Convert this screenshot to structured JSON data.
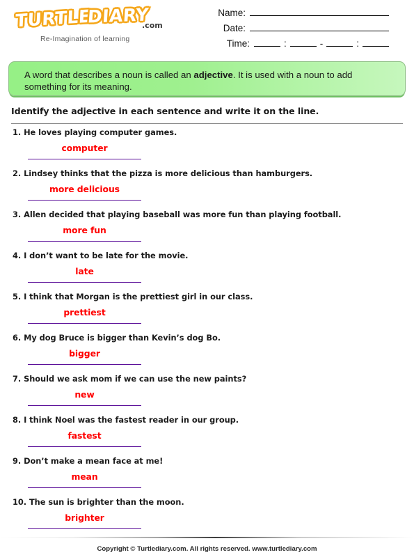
{
  "brand": {
    "logo_word_1": "TURTLE",
    "logo_word_2": "DIARY",
    "logo_suffix": ".com",
    "tagline": "Re-Imagination of learning"
  },
  "form": {
    "name_label": "Name:",
    "date_label": "Date:",
    "time_label": "Time:",
    "time_colon_1": ":",
    "time_dash": "-",
    "time_colon_2": ":"
  },
  "note": {
    "part_1": "A word that describes a noun is called an ",
    "bold_term": "adjective",
    "part_2": ". It is used with a noun to add something for its meaning.",
    "background_color": "#96f086",
    "border_color": "#8fbf86"
  },
  "instruction": "Identify the adjective in each sentence and write it on the line.",
  "answer_color": "#ff0000",
  "rule_color": "#5b0f99",
  "questions": [
    {
      "number": "1.",
      "sentence": "He loves playing computer games.",
      "answer": "computer"
    },
    {
      "number": "2.",
      "sentence": "Lindsey thinks that the pizza is more delicious than hamburgers.",
      "answer": "more delicious"
    },
    {
      "number": "3.",
      "sentence": "Allen decided that playing baseball was more fun than playing football.",
      "answer": "more fun"
    },
    {
      "number": "4.",
      "sentence": "I don’t want to be late for the movie.",
      "answer": "late"
    },
    {
      "number": "5.",
      "sentence": "I think that Morgan is the prettiest girl in our class.",
      "answer": "prettiest"
    },
    {
      "number": "6.",
      "sentence": "My dog Bruce is bigger than Kevin’s dog Bo.",
      "answer": "bigger"
    },
    {
      "number": "7.",
      "sentence": "Should we ask mom if we can use the new paints?",
      "answer": "new"
    },
    {
      "number": "8.",
      "sentence": "I think Noel was the fastest reader in our group.",
      "answer": "fastest"
    },
    {
      "number": "9.",
      "sentence": "Don’t make a mean face at me!",
      "answer": "mean"
    },
    {
      "number": "10.",
      "sentence": "The sun is brighter than the moon.",
      "answer": "brighter"
    }
  ],
  "footer": "Copyright © Turtlediary.com. All rights reserved. www.turtlediary.com"
}
